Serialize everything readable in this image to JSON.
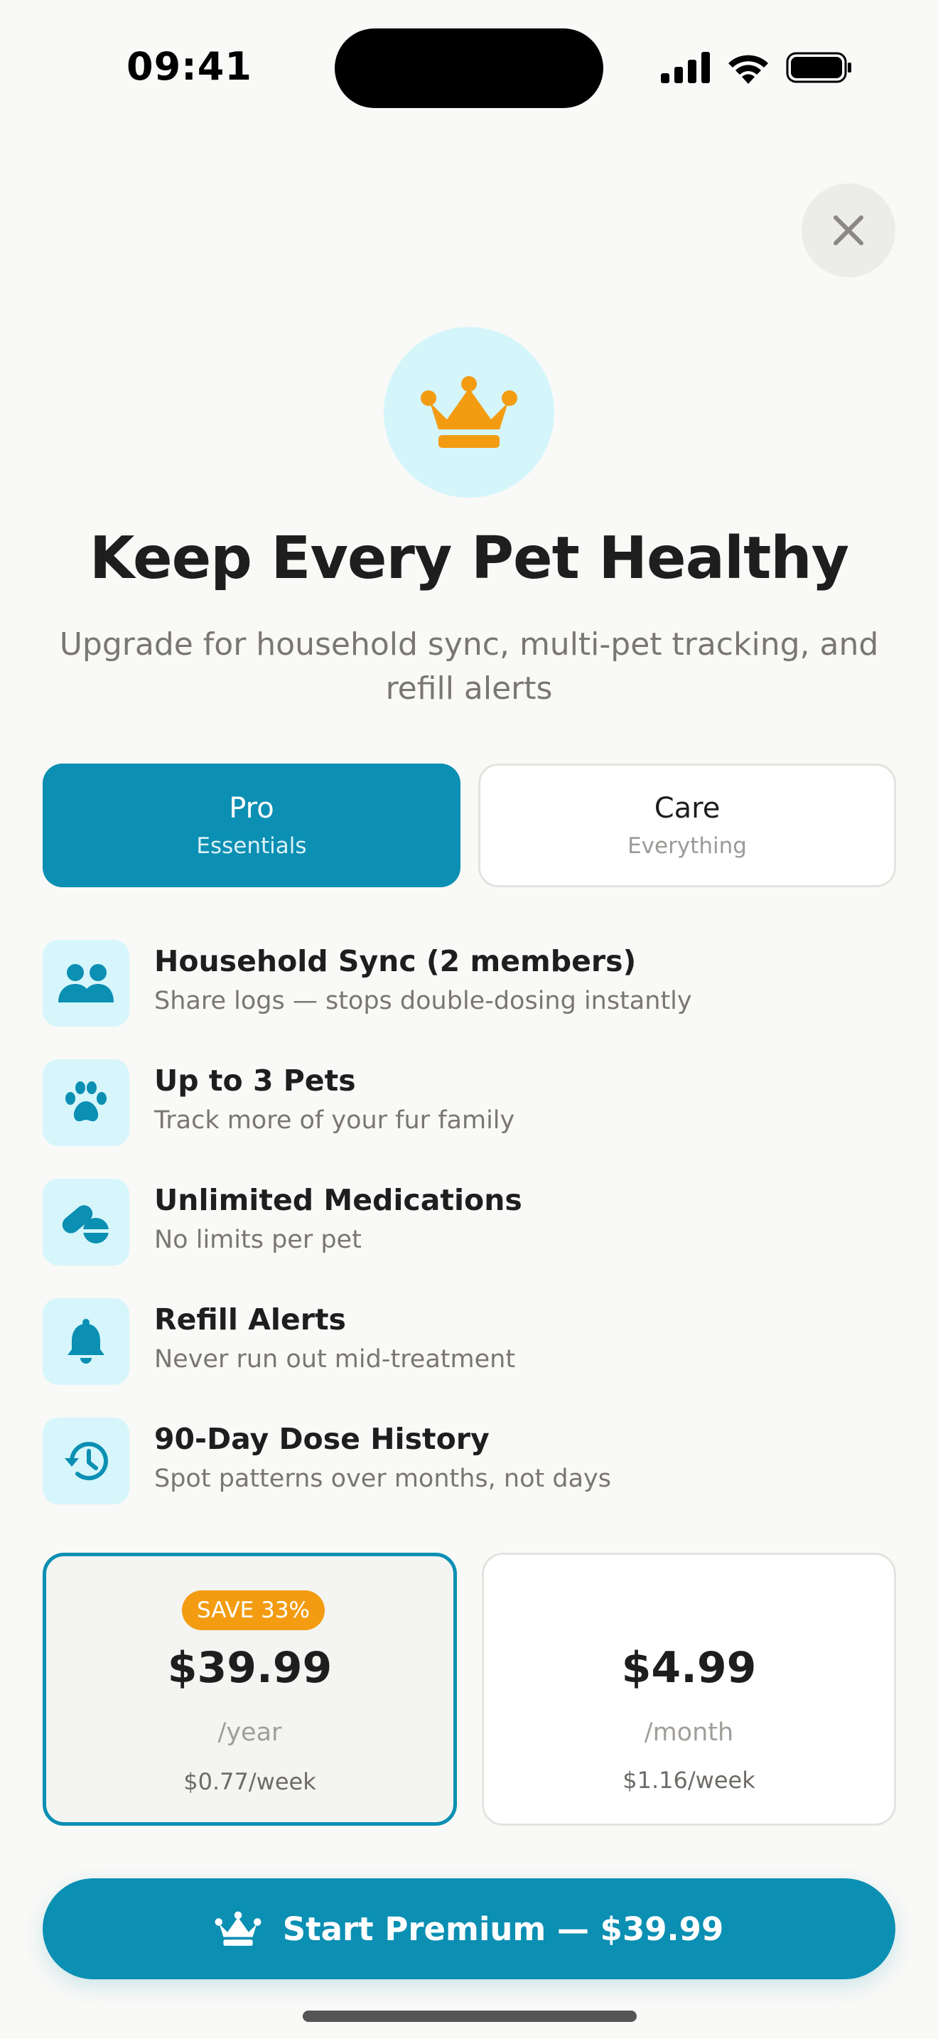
{
  "status_bar": {
    "time": "09:41"
  },
  "header": {
    "close_icon": "close-icon"
  },
  "hero": {
    "icon": "crown-icon",
    "title": "Keep Every Pet Healthy",
    "subtitle": "Upgrade for household sync, multi-pet tracking, and refill alerts"
  },
  "tiers": [
    {
      "name": "Pro",
      "subtitle": "Essentials",
      "selected": true
    },
    {
      "name": "Care",
      "subtitle": "Everything",
      "selected": false
    }
  ],
  "features": [
    {
      "icon": "people-icon",
      "title": "Household Sync (2 members)",
      "description": "Share logs — stops double-dosing instantly"
    },
    {
      "icon": "paw-icon",
      "title": "Up to 3 Pets",
      "description": "Track more of your fur family"
    },
    {
      "icon": "pills-icon",
      "title": "Unlimited Medications",
      "description": "No limits per pet"
    },
    {
      "icon": "bell-icon",
      "title": "Refill Alerts",
      "description": "Never run out mid-treatment"
    },
    {
      "icon": "history-icon",
      "title": "90-Day Dose History",
      "description": "Spot patterns over months, not days"
    }
  ],
  "plans": [
    {
      "badge": "SAVE 33%",
      "price": "$39.99",
      "period": "/year",
      "weekly": "$0.77/week",
      "selected": true
    },
    {
      "price": "$4.99",
      "period": "/month",
      "weekly": "$1.16/week",
      "selected": false
    }
  ],
  "cta": {
    "icon": "crown-icon",
    "label": "Start Premium — $39.99"
  },
  "colors": {
    "accent": "#0b8fb3",
    "badge": "#f39c12",
    "icon_bg": "#d6f6fb",
    "crown": "#f39c12"
  }
}
